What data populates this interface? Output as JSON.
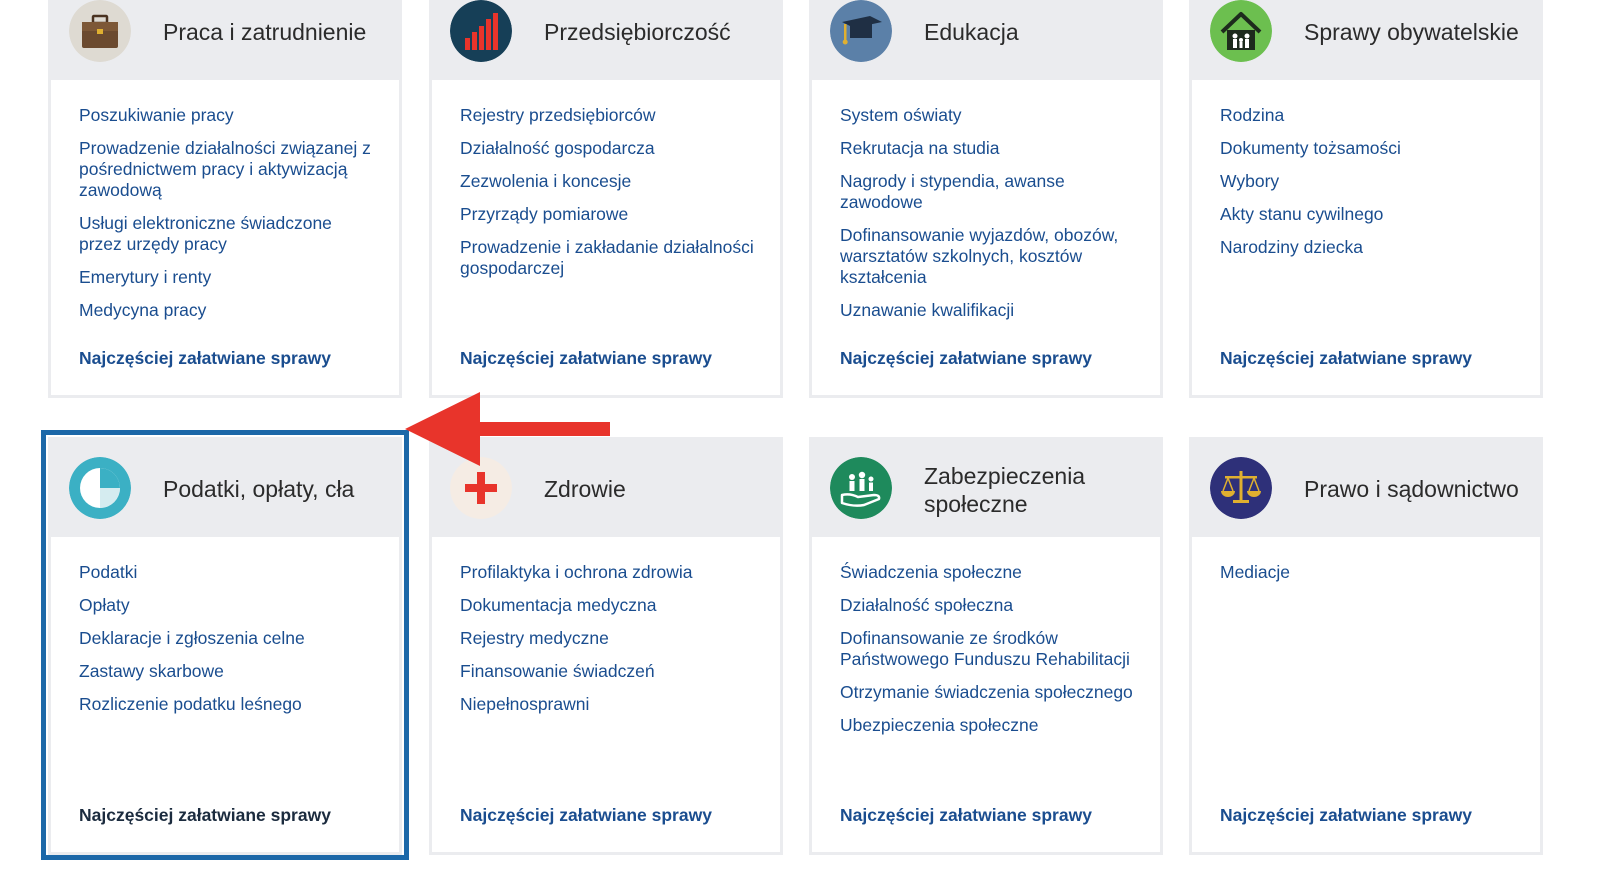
{
  "colors": {
    "link": "#1a4d8f",
    "header_bg": "#ebecef",
    "highlight_border": "#1c68a8",
    "arrow": "#e8342b"
  },
  "categories": [
    {
      "title": "Praca i zatrudnienie",
      "icon": "briefcase-icon",
      "links": [
        "Poszukiwanie pracy",
        "Prowadzenie działalności związanej z pośrednictwem pracy i aktywizacją zawodową",
        "Usługi elektroniczne świadczone przez urzędy pracy",
        "Emerytury i renty",
        "Medycyna pracy"
      ],
      "frequent": "Najczęściej załatwiane sprawy"
    },
    {
      "title": "Przedsiębiorczość",
      "icon": "bar-chart-icon",
      "links": [
        "Rejestry przedsiębiorców",
        "Działalność gospodarcza",
        "Zezwolenia i koncesje",
        "Przyrządy pomiarowe",
        "Prowadzenie i zakładanie działalności gospodarczej"
      ],
      "frequent": "Najczęściej załatwiane sprawy"
    },
    {
      "title": "Edukacja",
      "icon": "graduation-cap-icon",
      "links": [
        "System oświaty",
        "Rekrutacja na studia",
        "Nagrody i stypendia, awanse zawodowe",
        "Dofinansowanie wyjazdów, obozów, warsztatów szkolnych, kosztów kształcenia",
        "Uznawanie kwalifikacji"
      ],
      "frequent": "Najczęściej załatwiane sprawy"
    },
    {
      "title": "Sprawy obywatelskie",
      "icon": "family-house-icon",
      "links": [
        "Rodzina",
        "Dokumenty tożsamości",
        "Wybory",
        "Akty stanu cywilnego",
        "Narodziny dziecka"
      ],
      "frequent": "Najczęściej załatwiane sprawy"
    },
    {
      "title": "Podatki, opłaty, cła",
      "icon": "pie-chart-icon",
      "links": [
        "Podatki",
        "Opłaty",
        "Deklaracje i zgłoszenia celne",
        "Zastawy skarbowe",
        "Rozliczenie podatku leśnego"
      ],
      "frequent": "Najczęściej załatwiane sprawy"
    },
    {
      "title": "Zdrowie",
      "icon": "medical-cross-icon",
      "links": [
        "Profilaktyka i ochrona zdrowia",
        "Dokumentacja medyczna",
        "Rejestry medyczne",
        "Finansowanie świadczeń",
        "Niepełnosprawni"
      ],
      "frequent": "Najczęściej załatwiane sprawy"
    },
    {
      "title": "Zabezpieczenia społeczne",
      "icon": "hand-people-icon",
      "links": [
        "Świadczenia społeczne",
        "Działalność społeczna",
        "Dofinansowanie ze środków Państwowego Funduszu Rehabilitacji",
        "Otrzymanie świadczenia społecznego",
        "Ubezpieczenia społeczne"
      ],
      "frequent": "Najczęściej załatwiane sprawy"
    },
    {
      "title": "Prawo i sądownictwo",
      "icon": "scales-icon",
      "links": [
        "Mediacje"
      ],
      "frequent": "Najczęściej załatwiane sprawy"
    }
  ]
}
